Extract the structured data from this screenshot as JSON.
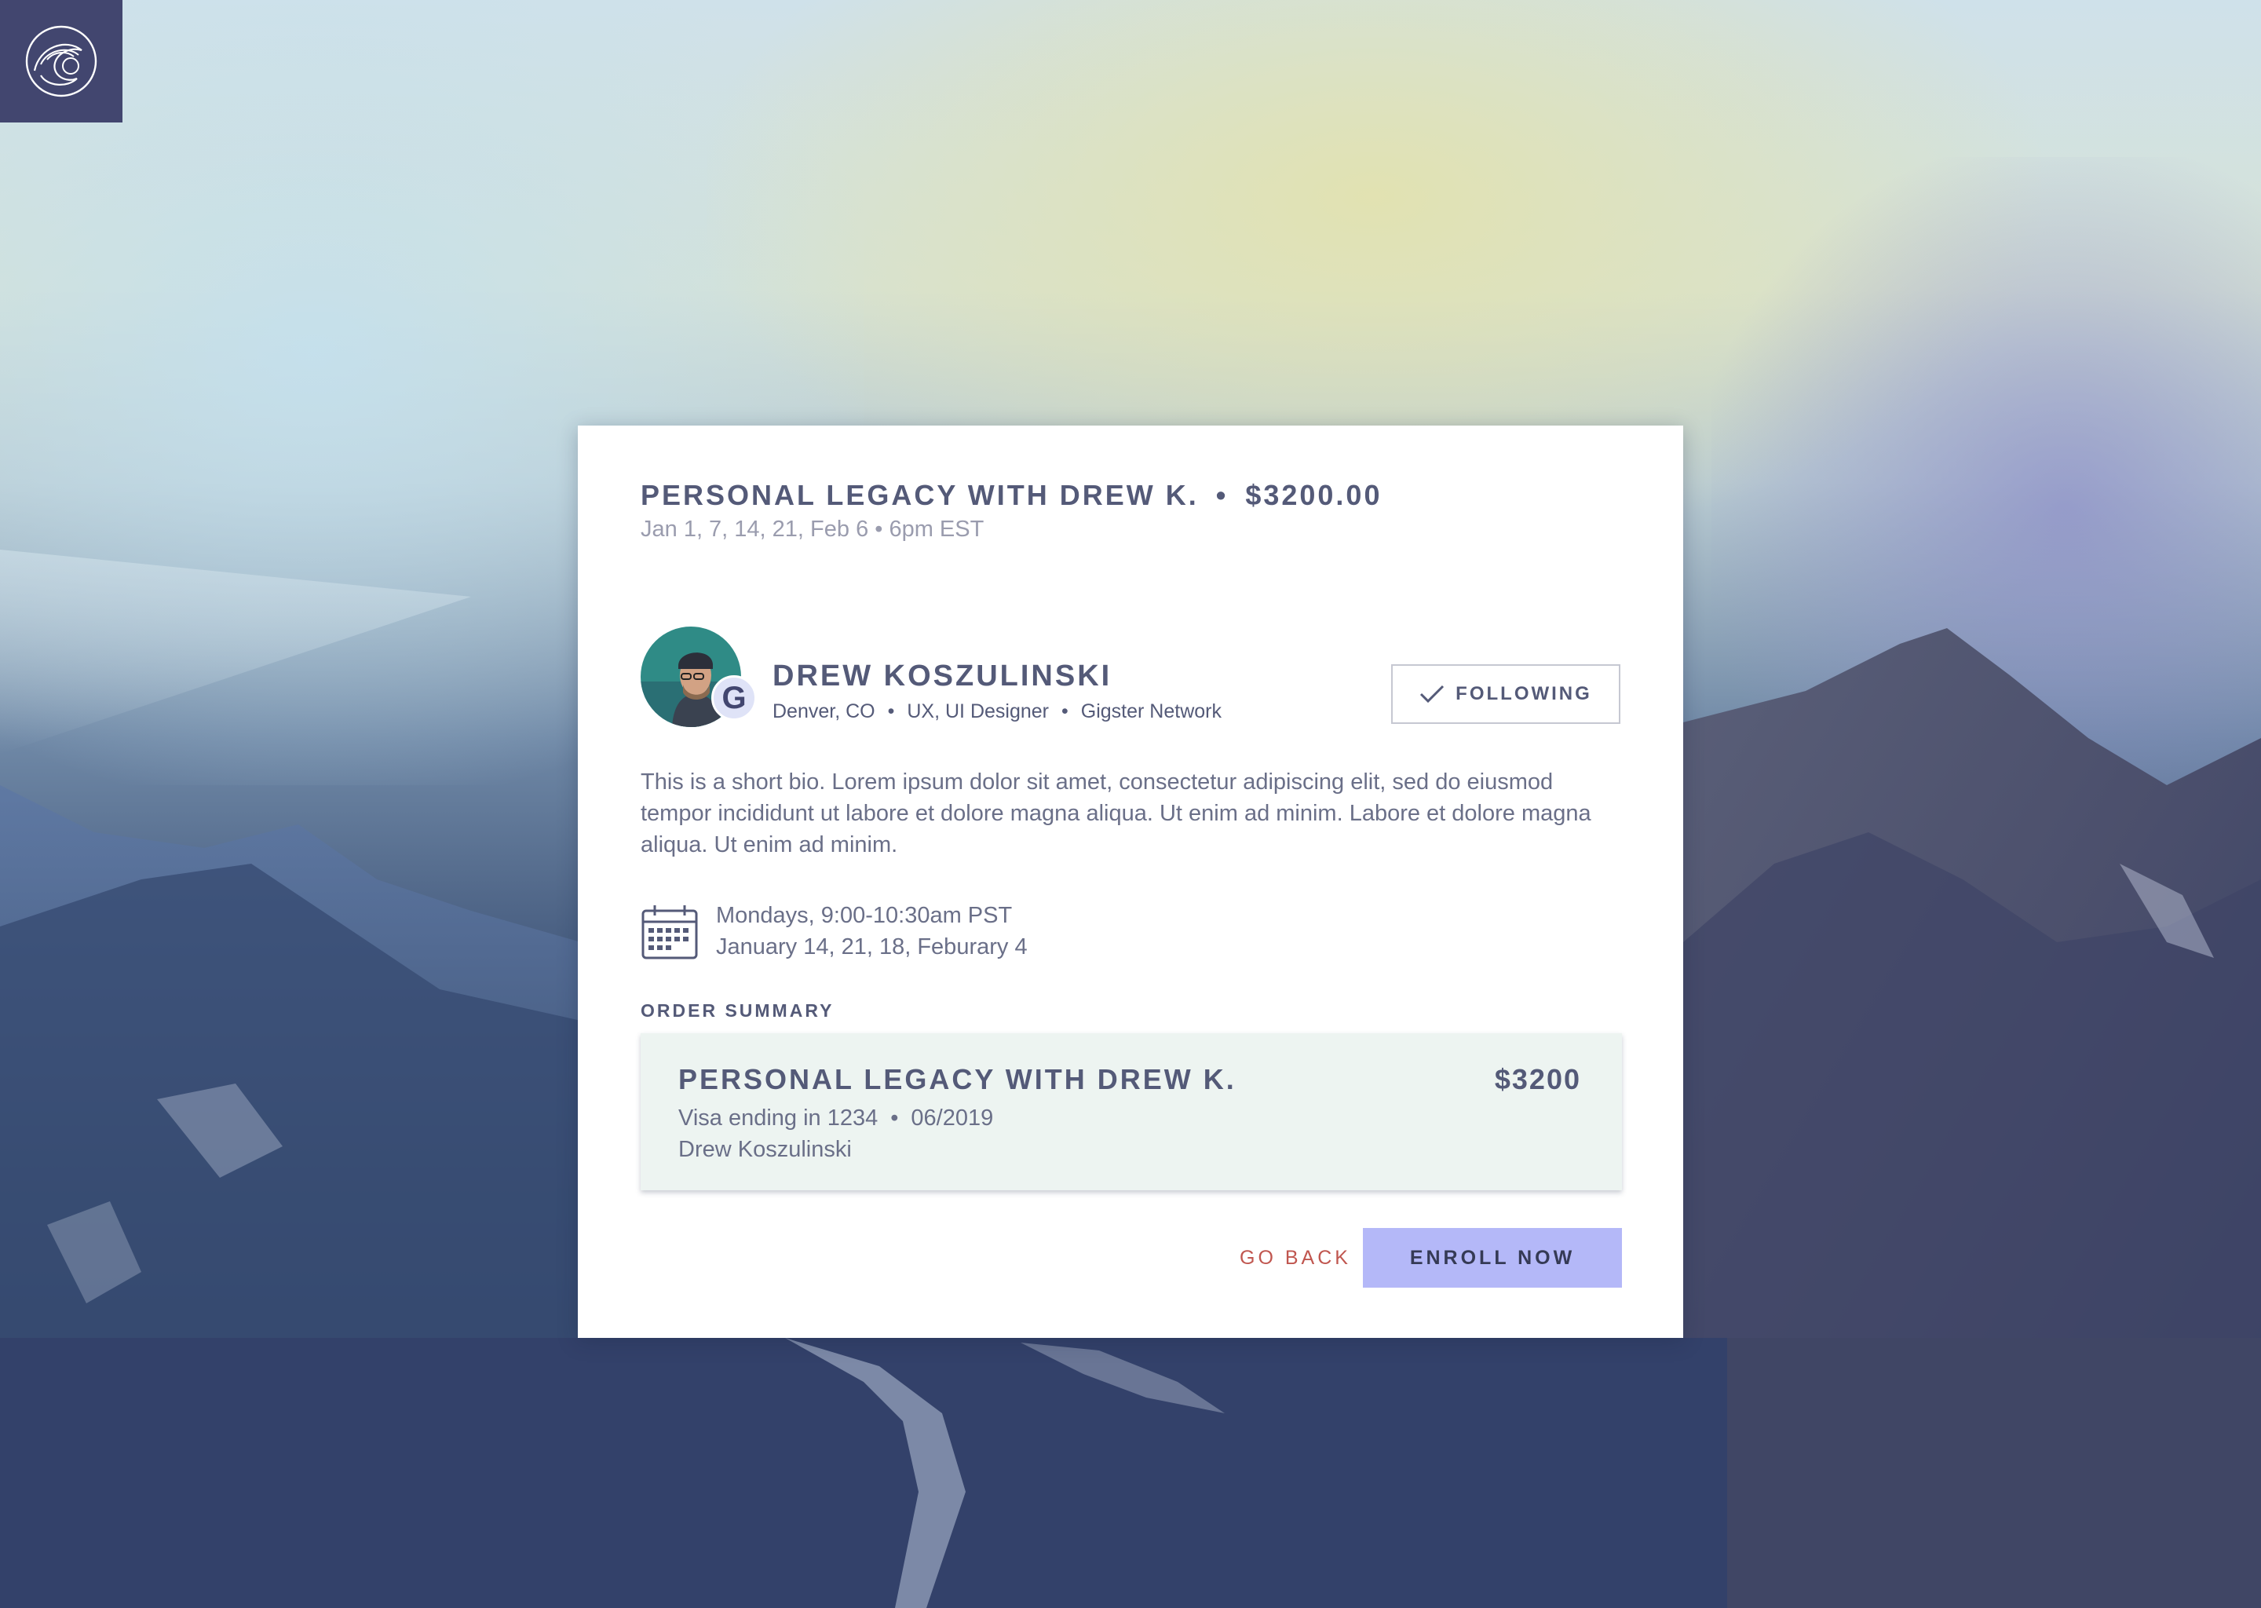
{
  "app": {
    "logo_icon": "wave-circle-icon",
    "brand_color": "#42466f"
  },
  "offer": {
    "title": "PERSONAL LEGACY WITH DREW K.",
    "separator": "•",
    "price": "$3200.00",
    "dates": "Jan 1, 7, 14, 21, Feb 6 • 6pm EST"
  },
  "host": {
    "name": "DREW KOSZULINSKI",
    "badge_letter": "G",
    "location": "Denver, CO",
    "role": "UX, UI Designer",
    "network": "Gigster Network",
    "meta_separator": "•",
    "follow_label": "FOLLOWING",
    "follow_icon": "checkmark-icon",
    "bio": "This is a short bio. Lorem ipsum dolor sit amet, consectetur adipiscing elit, sed do eiusmod tempor incididunt ut labore et dolore magna aliqua. Ut enim ad minim. Labore et dolore magna aliqua. Ut enim ad minim."
  },
  "schedule": {
    "icon": "calendar-icon",
    "line1": "Mondays, 9:00-10:30am PST",
    "line2": "January 14, 21, 18, Feburary 4"
  },
  "order_summary": {
    "label": "ORDER SUMMARY",
    "item_title": "PERSONAL LEGACY WITH DREW K.",
    "item_price": "$3200",
    "card_text": "Visa ending in 1234",
    "card_separator": "•",
    "card_expiry": "06/2019",
    "cardholder": "Drew Koszulinski",
    "background_color": "#edf4f1"
  },
  "actions": {
    "back_label": "GO BACK",
    "enroll_label": "ENROLL NOW",
    "back_color": "#c0564f",
    "enroll_color": "#b4b8f8"
  }
}
